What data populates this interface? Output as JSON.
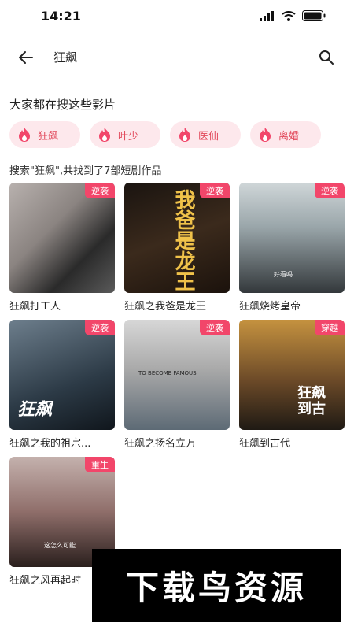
{
  "status_bar": {
    "time": "14:21"
  },
  "header": {
    "query": "狂飙"
  },
  "hot": {
    "title": "大家都在搜这些影片",
    "chips": [
      {
        "label": "狂飙"
      },
      {
        "label": "叶少"
      },
      {
        "label": "医仙"
      },
      {
        "label": "离婚"
      }
    ]
  },
  "results": {
    "summary": "搜索\"狂飙\",共找到了7部短剧作品",
    "items": [
      {
        "title": "狂飙打工人",
        "badge": "逆袭"
      },
      {
        "title": "狂飙之我爸是龙王",
        "badge": "逆袭",
        "poster_text": "我爸是龙王"
      },
      {
        "title": "狂飙烧烤皇帝",
        "badge": "逆袭",
        "poster_text": "好看吗"
      },
      {
        "title": "狂飙之我的祖宗...",
        "badge": "逆袭",
        "poster_text": "狂飙"
      },
      {
        "title": "狂飙之扬名立万",
        "badge": "逆袭",
        "poster_text": "TO BECOME FAMOUS"
      },
      {
        "title": "狂飙到古代",
        "badge": "穿越",
        "poster_text": "狂飙到古"
      },
      {
        "title": "狂飙之风再起时",
        "badge": "重生",
        "poster_text": "这怎么可能"
      }
    ]
  },
  "watermark": {
    "text": "下载鸟资源"
  },
  "colors": {
    "accent": "#f2466a",
    "chip_bg": "#fde8ec",
    "chip_text": "#e24a5c"
  }
}
